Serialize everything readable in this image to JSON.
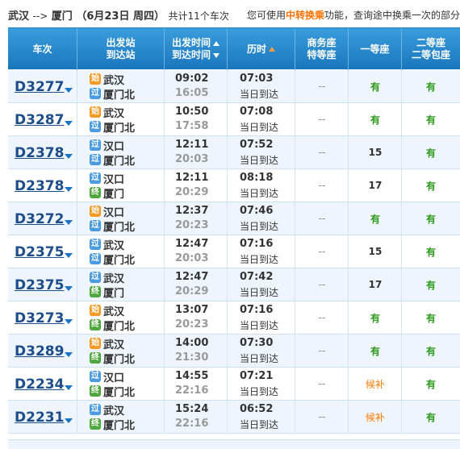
{
  "header": {
    "from": "武汉",
    "arrow": "-->",
    "to": "厦门",
    "date": "（6月23日  周四）",
    "count": "共计11个车次",
    "tip_prefix": "您可使用",
    "tip_highlight": "中转换乘",
    "tip_suffix": "功能，查询途中换乘一次的部分"
  },
  "columns": {
    "train": "车次",
    "station_top": "出发站",
    "station_bottom": "到达站",
    "time_top": "出发时间",
    "time_bottom": "到达时间",
    "duration": "历时",
    "business_top": "商务座",
    "business_bottom": "特等座",
    "first": "一等座",
    "second_top": "二等座",
    "second_bottom": "二等包座"
  },
  "badges": {
    "start": "始",
    "pass": "过",
    "end": "终"
  },
  "rows": [
    {
      "train": "D3277",
      "from": "武汉",
      "from_badge": "start",
      "to": "厦门北",
      "to_badge": "pass",
      "dep": "09:02",
      "arr": "16:05",
      "dur": "07:03",
      "day": "当日到达",
      "business": "--",
      "first": "有",
      "second": "有"
    },
    {
      "train": "D3287",
      "from": "武汉",
      "from_badge": "start",
      "to": "厦门北",
      "to_badge": "pass",
      "dep": "10:50",
      "arr": "17:58",
      "dur": "07:08",
      "day": "当日到达",
      "business": "--",
      "first": "有",
      "second": "有"
    },
    {
      "train": "D2378",
      "from": "汉口",
      "from_badge": "pass",
      "to": "厦门北",
      "to_badge": "pass",
      "dep": "12:11",
      "arr": "20:03",
      "dur": "07:52",
      "day": "当日到达",
      "business": "--",
      "first": "15",
      "second": "有"
    },
    {
      "train": "D2378",
      "from": "汉口",
      "from_badge": "pass",
      "to": "厦门",
      "to_badge": "end",
      "dep": "12:11",
      "arr": "20:29",
      "dur": "08:18",
      "day": "当日到达",
      "business": "--",
      "first": "17",
      "second": "有"
    },
    {
      "train": "D3272",
      "from": "汉口",
      "from_badge": "start",
      "to": "厦门北",
      "to_badge": "pass",
      "dep": "12:37",
      "arr": "20:23",
      "dur": "07:46",
      "day": "当日到达",
      "business": "--",
      "first": "有",
      "second": "有"
    },
    {
      "train": "D2375",
      "from": "武汉",
      "from_badge": "pass",
      "to": "厦门北",
      "to_badge": "pass",
      "dep": "12:47",
      "arr": "20:03",
      "dur": "07:16",
      "day": "当日到达",
      "business": "--",
      "first": "15",
      "second": "有"
    },
    {
      "train": "D2375",
      "from": "武汉",
      "from_badge": "pass",
      "to": "厦门",
      "to_badge": "end",
      "dep": "12:47",
      "arr": "20:29",
      "dur": "07:42",
      "day": "当日到达",
      "business": "--",
      "first": "17",
      "second": "有"
    },
    {
      "train": "D3273",
      "from": "武汉",
      "from_badge": "start",
      "to": "厦门北",
      "to_badge": "end",
      "dep": "13:07",
      "arr": "20:23",
      "dur": "07:16",
      "day": "当日到达",
      "business": "--",
      "first": "有",
      "second": "有"
    },
    {
      "train": "D3289",
      "from": "武汉",
      "from_badge": "start",
      "to": "厦门北",
      "to_badge": "end",
      "dep": "14:00",
      "arr": "21:30",
      "dur": "07:30",
      "day": "当日到达",
      "business": "--",
      "first": "有",
      "second": "有"
    },
    {
      "train": "D2234",
      "from": "汉口",
      "from_badge": "pass",
      "to": "厦门北",
      "to_badge": "end",
      "dep": "14:55",
      "arr": "22:16",
      "dur": "07:21",
      "day": "当日到达",
      "business": "--",
      "first": "候补",
      "second": "有"
    },
    {
      "train": "D2231",
      "from": "武汉",
      "from_badge": "pass",
      "to": "厦门北",
      "to_badge": "end",
      "dep": "15:24",
      "arr": "22:16",
      "dur": "06:52",
      "day": "当日到达",
      "business": "--",
      "first": "候补",
      "second": "有"
    }
  ]
}
